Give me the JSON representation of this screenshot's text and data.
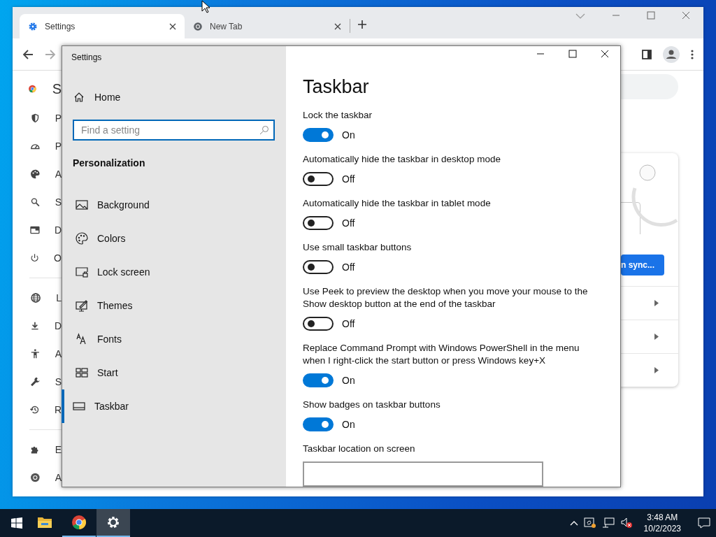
{
  "browser": {
    "tabs": [
      {
        "label": "Settings",
        "selected": true
      },
      {
        "label": "New Tab",
        "selected": false
      }
    ],
    "page_title": "S",
    "sidebar": {
      "groups": [
        [
          "P",
          "P",
          "A",
          "S",
          "D",
          "O"
        ],
        [
          "L",
          "D",
          "A",
          "S",
          "R"
        ],
        [
          "E",
          "A"
        ]
      ]
    },
    "sync_button": "n sync..."
  },
  "settings_window": {
    "title": "Settings",
    "home": "Home",
    "search": {
      "placeholder": "Find a setting"
    },
    "section": "Personalization",
    "nav": [
      {
        "label": "Background",
        "selected": false
      },
      {
        "label": "Colors",
        "selected": false
      },
      {
        "label": "Lock screen",
        "selected": false
      },
      {
        "label": "Themes",
        "selected": false
      },
      {
        "label": "Fonts",
        "selected": false
      },
      {
        "label": "Start",
        "selected": false
      },
      {
        "label": "Taskbar",
        "selected": true
      }
    ],
    "heading": "Taskbar",
    "toggles": [
      {
        "label": "Lock the taskbar",
        "on": true,
        "state_text": "On"
      },
      {
        "label": "Automatically hide the taskbar in desktop mode",
        "on": false,
        "state_text": "Off"
      },
      {
        "label": "Automatically hide the taskbar in tablet mode",
        "on": false,
        "state_text": "Off"
      },
      {
        "label": "Use small taskbar buttons",
        "on": false,
        "state_text": "Off"
      },
      {
        "label": "Use Peek to preview the desktop when you move your mouse to the Show desktop button at the end of the taskbar",
        "on": false,
        "state_text": "Off"
      },
      {
        "label": "Replace Command Prompt with Windows PowerShell in the menu when I right-click the start button or press Windows key+X",
        "on": true,
        "state_text": "On"
      },
      {
        "label": "Show badges on taskbar buttons",
        "on": true,
        "state_text": "On"
      }
    ],
    "location_label": "Taskbar location on screen"
  },
  "taskbar": {
    "apps": [
      {
        "running": false,
        "selected": false
      },
      {
        "running": true,
        "selected": false
      },
      {
        "running": true,
        "selected": true
      }
    ],
    "time": "3:48 AM",
    "date": "10/2/2023"
  }
}
